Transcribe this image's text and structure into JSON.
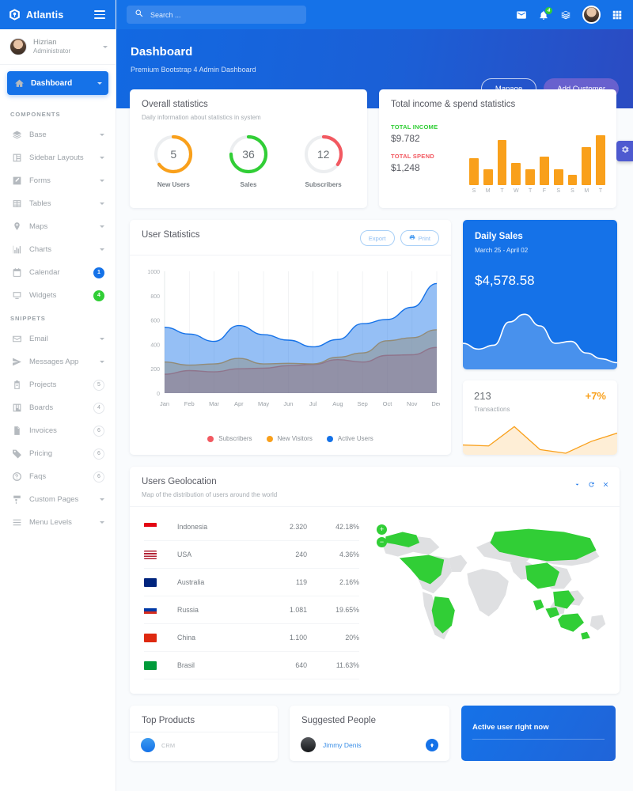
{
  "brand": {
    "name": "Atlantis",
    "logo_icon": "atlantis-logo-icon",
    "menu_icon": "hamburger-icon"
  },
  "colors": {
    "primary": "#1572e8",
    "purple": "#6861ce",
    "green": "#31ce36",
    "orange": "#f9a01b",
    "red": "#f25961",
    "bg": "#f9fbfd"
  },
  "search": {
    "placeholder": "Search ...",
    "icon": "search-icon"
  },
  "topnav": {
    "icons": [
      {
        "name": "mail-icon",
        "label": "Messages"
      },
      {
        "name": "bell-icon",
        "label": "Notifications",
        "badge": "4"
      },
      {
        "name": "layers-icon",
        "label": "Quick Actions"
      },
      {
        "name": "avatar",
        "label": "Profile"
      },
      {
        "name": "grid-icon",
        "label": "Apps"
      }
    ]
  },
  "sidebar": {
    "user": {
      "name": "Hizrian",
      "role": "Administrator",
      "avatar": "avatar",
      "caret": "chevron-down-icon"
    },
    "active_item": {
      "label": "Dashboard",
      "icon": "home-icon",
      "caret": "chevron-down-icon"
    },
    "sections": [
      {
        "title": "COMPONENTS",
        "items": [
          {
            "label": "Base",
            "icon": "layers-icon",
            "trailing": "caret"
          },
          {
            "label": "Sidebar Layouts",
            "icon": "sidebar-icon",
            "trailing": "caret"
          },
          {
            "label": "Forms",
            "icon": "pencil-square-icon",
            "trailing": "caret"
          },
          {
            "label": "Tables",
            "icon": "table-icon",
            "trailing": "caret"
          },
          {
            "label": "Maps",
            "icon": "map-pin-icon",
            "trailing": "caret"
          },
          {
            "label": "Charts",
            "icon": "bar-chart-icon",
            "trailing": "caret"
          },
          {
            "label": "Calendar",
            "icon": "calendar-icon",
            "trailing": "badge",
            "badge": "1",
            "badge_color": "blue"
          },
          {
            "label": "Widgets",
            "icon": "monitor-icon",
            "trailing": "badge",
            "badge": "4",
            "badge_color": "green"
          }
        ]
      },
      {
        "title": "SNIPPETS",
        "items": [
          {
            "label": "Email",
            "icon": "envelope-icon",
            "trailing": "caret"
          },
          {
            "label": "Messages App",
            "icon": "paper-plane-icon",
            "trailing": "caret"
          },
          {
            "label": "Projects",
            "icon": "clipboard-icon",
            "trailing": "badge",
            "badge": "5",
            "badge_color": "gray"
          },
          {
            "label": "Boards",
            "icon": "kanban-icon",
            "trailing": "badge",
            "badge": "4",
            "badge_color": "gray"
          },
          {
            "label": "Invoices",
            "icon": "file-icon",
            "trailing": "badge",
            "badge": "6",
            "badge_color": "gray"
          },
          {
            "label": "Pricing",
            "icon": "tag-icon",
            "trailing": "badge",
            "badge": "6",
            "badge_color": "gray"
          },
          {
            "label": "Faqs",
            "icon": "question-circle-icon",
            "trailing": "badge",
            "badge": "6",
            "badge_color": "gray"
          },
          {
            "label": "Custom Pages",
            "icon": "brush-icon",
            "trailing": "caret"
          },
          {
            "label": "Menu Levels",
            "icon": "list-icon",
            "trailing": "caret"
          }
        ]
      }
    ]
  },
  "banner": {
    "title": "Dashboard",
    "subtitle": "Premium Bootstrap 4 Admin Dashboard",
    "manage_label": "Manage",
    "add_customer_label": "Add Customer"
  },
  "overall_statistics": {
    "title": "Overall statistics",
    "subtitle": "Daily information about statistics in system",
    "gauges": [
      {
        "value": "5",
        "label": "New Users",
        "percent": 65,
        "color": "#f9a01b"
      },
      {
        "value": "36",
        "label": "Sales",
        "percent": 75,
        "color": "#31ce36"
      },
      {
        "value": "12",
        "label": "Subscribers",
        "percent": 35,
        "color": "#f25961"
      }
    ]
  },
  "income_statistics": {
    "title": "Total income & spend statistics",
    "total_income_label": "TOTAL INCOME",
    "total_income_value": "$9.782",
    "total_spend_label": "TOTAL SPEND",
    "total_spend_value": "$1,248"
  },
  "user_statistics": {
    "title": "User Statistics",
    "export_label": "Export",
    "print_label": "Print",
    "legend": [
      {
        "label": "Subscribers",
        "color": "#f25961"
      },
      {
        "label": "New Visitors",
        "color": "#f9a01b"
      },
      {
        "label": "Active Users",
        "color": "#1572e8"
      }
    ]
  },
  "daily_sales": {
    "title": "Daily Sales",
    "range": "March 25 - April 02",
    "amount": "$4,578.58"
  },
  "transactions": {
    "count": "213",
    "change": "+7%",
    "label": "Transactions"
  },
  "geolocation": {
    "title": "Users Geolocation",
    "subtitle": "Map of the distribution of users around the world",
    "actions": [
      {
        "name": "chevron-down-icon"
      },
      {
        "name": "refresh-icon"
      },
      {
        "name": "close-icon"
      }
    ],
    "zoom_in": "+",
    "zoom_out": "−",
    "rows": [
      {
        "country": "Indonesia",
        "count": "2.320",
        "percent": "42.18%",
        "flag": "id"
      },
      {
        "country": "USA",
        "count": "240",
        "percent": "4.36%",
        "flag": "us"
      },
      {
        "country": "Australia",
        "count": "119",
        "percent": "2.16%",
        "flag": "au"
      },
      {
        "country": "Russia",
        "count": "1.081",
        "percent": "19.65%",
        "flag": "ru"
      },
      {
        "country": "China",
        "count": "1.100",
        "percent": "20%",
        "flag": "cn"
      },
      {
        "country": "Brasil",
        "count": "640",
        "percent": "11.63%",
        "flag": "br"
      }
    ]
  },
  "bottom": {
    "top_products": {
      "title": "Top Products",
      "first_item": "CRM"
    },
    "suggested_people": {
      "title": "Suggested People",
      "first_name": "Jimmy Denis",
      "add_icon": "plus-icon"
    },
    "active_user": {
      "title": "Active user right now"
    }
  },
  "settings_tab": {
    "icon": "gear-icon"
  },
  "chart_data": [
    {
      "type": "bar",
      "title": "Total income & spend statistics",
      "categories": [
        "S",
        "M",
        "T",
        "W",
        "T",
        "F",
        "S",
        "S",
        "M",
        "T"
      ],
      "values": [
        52,
        30,
        86,
        42,
        31,
        55,
        31,
        20,
        73,
        95
      ],
      "ylim": [
        0,
        100
      ],
      "color": "#f9a01b",
      "grid": false,
      "legend": "none"
    },
    {
      "type": "area",
      "title": "User Statistics",
      "xlabel": "",
      "ylabel": "",
      "ylim": [
        0,
        1000
      ],
      "yticks": [
        0,
        200,
        400,
        600,
        800,
        1000
      ],
      "categories": [
        "Jan",
        "Feb",
        "Mar",
        "Apr",
        "May",
        "Jun",
        "Jul",
        "Aug",
        "Sep",
        "Oct",
        "Nov",
        "Dec"
      ],
      "stacked": true,
      "grid": true,
      "legend": "bottom",
      "series": [
        {
          "name": "Subscribers",
          "color": "#f25961",
          "values": [
            155,
            185,
            175,
            200,
            205,
            225,
            235,
            275,
            255,
            310,
            315,
            375
          ]
        },
        {
          "name": "New Visitors",
          "color": "#f9a01b",
          "values": [
            100,
            45,
            65,
            85,
            35,
            20,
            5,
            20,
            75,
            120,
            140,
            145
          ]
        },
        {
          "name": "Active Users",
          "color": "#1572e8",
          "values": [
            285,
            255,
            185,
            270,
            240,
            190,
            140,
            145,
            240,
            175,
            250,
            380
          ]
        }
      ]
    },
    {
      "type": "area",
      "title": "Daily Sales",
      "values": [
        40,
        34,
        38,
        62,
        70,
        58,
        40,
        42,
        30,
        24,
        20
      ],
      "color": "#ffffff",
      "grid": false,
      "legend": "none"
    },
    {
      "type": "line",
      "title": "Transactions",
      "values": [
        22,
        20,
        62,
        12,
        4,
        30,
        48
      ],
      "color": "#f9a01b",
      "grid": false,
      "legend": "none"
    }
  ]
}
